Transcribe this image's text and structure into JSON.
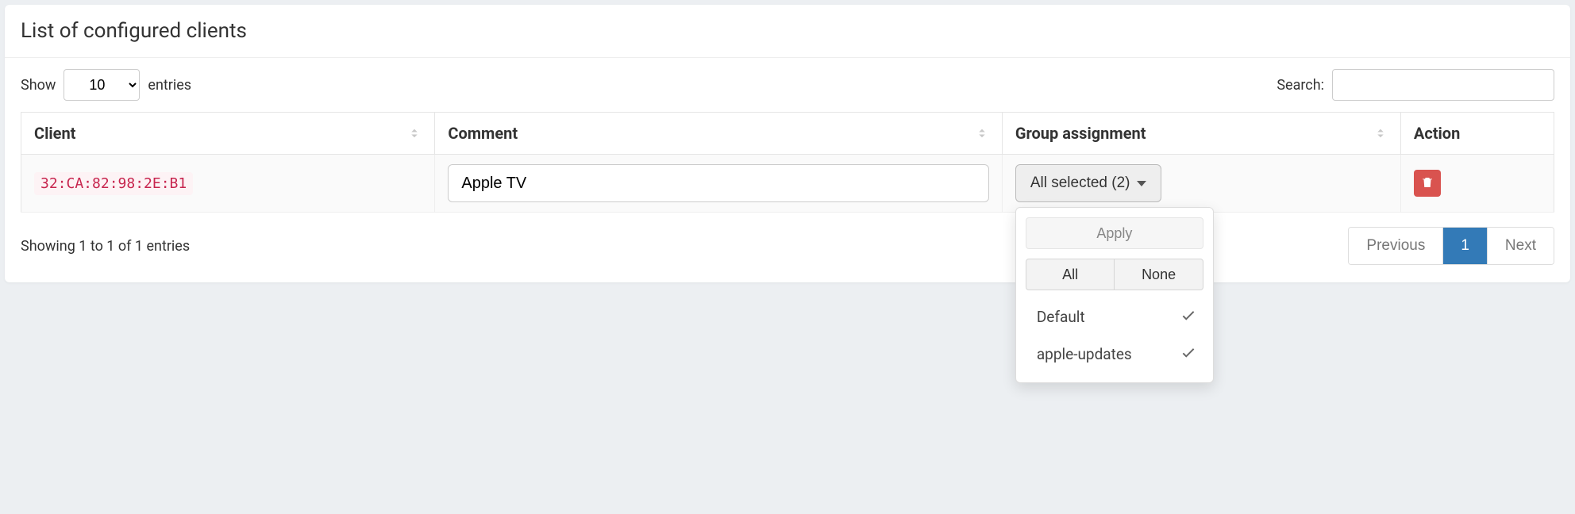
{
  "panel": {
    "title": "List of configured clients"
  },
  "lengthMenu": {
    "show": "Show",
    "entries": "entries",
    "value": "10"
  },
  "search": {
    "label": "Search:",
    "value": ""
  },
  "columns": {
    "client": "Client",
    "comment": "Comment",
    "group": "Group assignment",
    "action": "Action"
  },
  "row": {
    "mac": "32:CA:82:98:2E:B1",
    "comment": "Apple TV",
    "groupButton": "All selected (2)"
  },
  "dropdown": {
    "apply": "Apply",
    "all": "All",
    "none": "None",
    "items": [
      {
        "label": "Default",
        "checked": true
      },
      {
        "label": "apple-updates",
        "checked": true
      }
    ]
  },
  "info": "Showing 1 to 1 of 1 entries",
  "pager": {
    "previous": "Previous",
    "page": "1",
    "next": "Next"
  },
  "colors": {
    "accent": "#337ab7",
    "danger": "#d9534f",
    "mac": "#c7254e"
  }
}
